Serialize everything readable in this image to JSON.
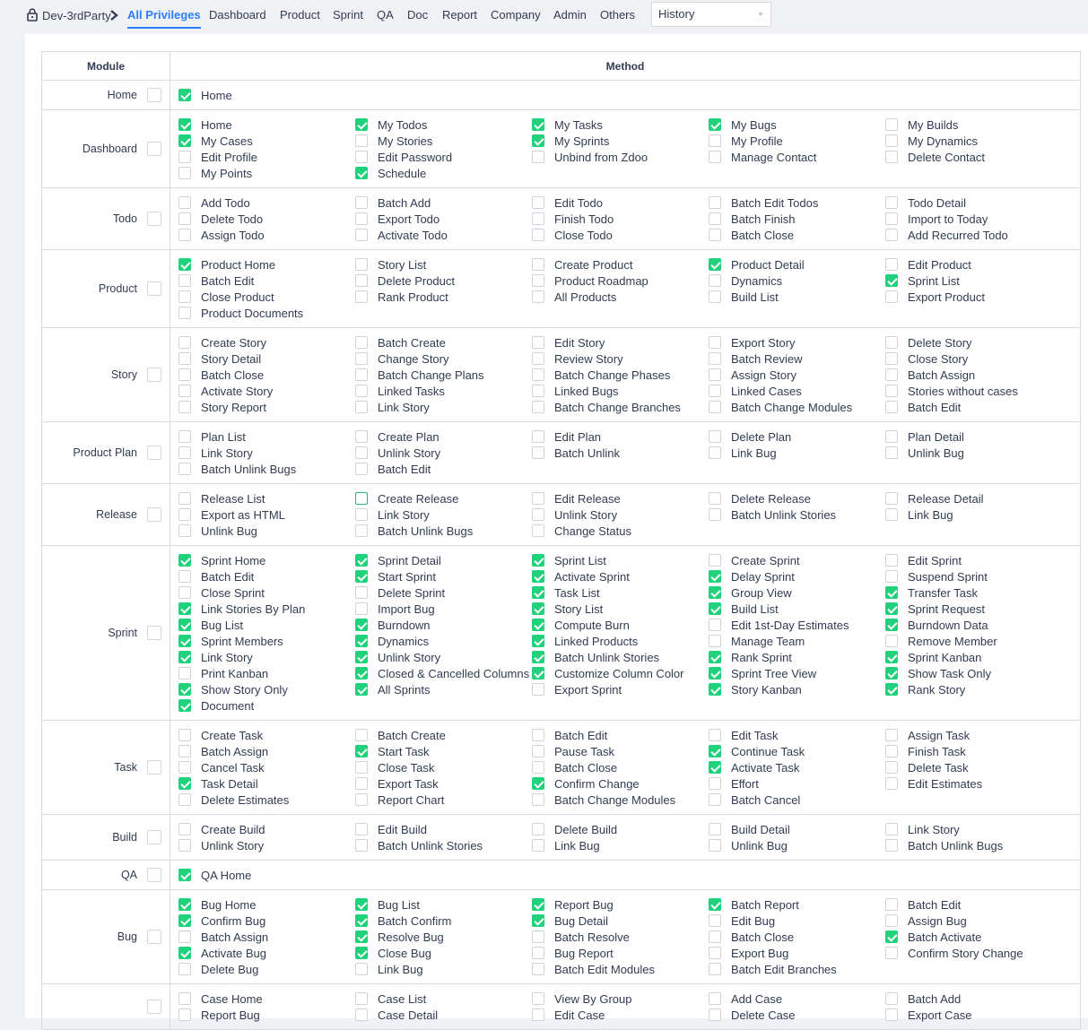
{
  "breadcrumb": {
    "root": "Dev-3rdParty",
    "current": "All Privileges"
  },
  "nav": [
    "Dashboard",
    "Product",
    "Sprint",
    "QA",
    "Doc",
    "Report",
    "Company",
    "Admin",
    "Others"
  ],
  "version_select": {
    "value": "History"
  },
  "table": {
    "header_module": "Module",
    "header_method": "Method"
  },
  "colors": {
    "checked": "#1fd27b",
    "accent": "#2e7fff",
    "border": "#d8dbde"
  },
  "modules": [
    {
      "name": "Home",
      "items": [
        [
          "Home",
          1
        ]
      ]
    },
    {
      "name": "Dashboard",
      "items": [
        [
          "Home",
          1
        ],
        [
          "My Todos",
          1
        ],
        [
          "My Tasks",
          1
        ],
        [
          "My Bugs",
          1
        ],
        [
          "My Builds",
          0
        ],
        [
          "My Cases",
          1
        ],
        [
          "My Stories",
          0
        ],
        [
          "My Sprints",
          1
        ],
        [
          "My Profile",
          0
        ],
        [
          "My Dynamics",
          0
        ],
        [
          "Edit Profile",
          0
        ],
        [
          "Edit Password",
          0
        ],
        [
          "Unbind from Zdoo",
          0
        ],
        [
          "Manage Contact",
          0
        ],
        [
          "Delete Contact",
          0
        ],
        [
          "My Points",
          0
        ],
        [
          "Schedule",
          1
        ]
      ]
    },
    {
      "name": "Todo",
      "items": [
        [
          "Add Todo",
          0
        ],
        [
          "Batch Add",
          0
        ],
        [
          "Edit Todo",
          0
        ],
        [
          "Batch Edit Todos",
          0
        ],
        [
          "Todo Detail",
          0
        ],
        [
          "Delete Todo",
          0
        ],
        [
          "Export Todo",
          0
        ],
        [
          "Finish Todo",
          0
        ],
        [
          "Batch Finish",
          0
        ],
        [
          "Import to Today",
          0
        ],
        [
          "Assign Todo",
          0
        ],
        [
          "Activate Todo",
          0
        ],
        [
          "Close Todo",
          0
        ],
        [
          "Batch Close",
          0
        ],
        [
          "Add Recurred Todo",
          0
        ]
      ]
    },
    {
      "name": "Product",
      "items": [
        [
          "Product Home",
          1
        ],
        [
          "Story List",
          0
        ],
        [
          "Create Product",
          0
        ],
        [
          "Product Detail",
          1
        ],
        [
          "Edit Product",
          0
        ],
        [
          "Batch Edit",
          0
        ],
        [
          "Delete Product",
          0
        ],
        [
          "Product Roadmap",
          0
        ],
        [
          "Dynamics",
          0
        ],
        [
          "Sprint List",
          1
        ],
        [
          "Close Product",
          0
        ],
        [
          "Rank Product",
          0
        ],
        [
          "All Products",
          0
        ],
        [
          "Build List",
          0
        ],
        [
          "Export Product",
          0
        ],
        [
          "Product Documents",
          0
        ]
      ]
    },
    {
      "name": "Story",
      "items": [
        [
          "Create Story",
          0
        ],
        [
          "Batch Create",
          0
        ],
        [
          "Edit Story",
          0
        ],
        [
          "Export Story",
          0
        ],
        [
          "Delete Story",
          0
        ],
        [
          "Story Detail",
          0
        ],
        [
          "Change Story",
          0
        ],
        [
          "Review Story",
          0
        ],
        [
          "Batch Review",
          0
        ],
        [
          "Close Story",
          0
        ],
        [
          "Batch Close",
          0
        ],
        [
          "Batch Change Plans",
          0
        ],
        [
          "Batch Change Phases",
          0
        ],
        [
          "Assign Story",
          0
        ],
        [
          "Batch Assign",
          0
        ],
        [
          "Activate Story",
          0
        ],
        [
          "Linked Tasks",
          0
        ],
        [
          "Linked Bugs",
          0
        ],
        [
          "Linked Cases",
          0
        ],
        [
          "Stories without cases",
          0
        ],
        [
          "Story Report",
          0
        ],
        [
          "Link Story",
          0
        ],
        [
          "Batch Change Branches",
          0
        ],
        [
          "Batch Change Modules",
          0
        ],
        [
          "Batch Edit",
          0
        ]
      ]
    },
    {
      "name": "Product Plan",
      "items": [
        [
          "Plan List",
          0
        ],
        [
          "Create Plan",
          0
        ],
        [
          "Edit Plan",
          0
        ],
        [
          "Delete Plan",
          0
        ],
        [
          "Plan Detail",
          0
        ],
        [
          "Link Story",
          0
        ],
        [
          "Unlink Story",
          0
        ],
        [
          "Batch Unlink",
          0
        ],
        [
          "Link Bug",
          0
        ],
        [
          "Unlink Bug",
          0
        ],
        [
          "Batch Unlink Bugs",
          0
        ],
        [
          "Batch Edit",
          0
        ]
      ]
    },
    {
      "name": "Release",
      "items": [
        [
          "Release List",
          0
        ],
        [
          "Create Release",
          2
        ],
        [
          "Edit Release",
          0
        ],
        [
          "Delete Release",
          0
        ],
        [
          "Release Detail",
          0
        ],
        [
          "Export as HTML",
          0
        ],
        [
          "Link Story",
          0
        ],
        [
          "Unlink Story",
          0
        ],
        [
          "Batch Unlink Stories",
          0
        ],
        [
          "Link Bug",
          0
        ],
        [
          "Unlink Bug",
          0
        ],
        [
          "Batch Unlink Bugs",
          0
        ],
        [
          "Change Status",
          0
        ]
      ]
    },
    {
      "name": "Sprint",
      "items": [
        [
          "Sprint Home",
          1
        ],
        [
          "Sprint Detail",
          1
        ],
        [
          "Sprint List",
          1
        ],
        [
          "Create Sprint",
          0
        ],
        [
          "Edit Sprint",
          0
        ],
        [
          "Batch Edit",
          0
        ],
        [
          "Start Sprint",
          1
        ],
        [
          "Activate Sprint",
          1
        ],
        [
          "Delay Sprint",
          1
        ],
        [
          "Suspend Sprint",
          0
        ],
        [
          "Close Sprint",
          0
        ],
        [
          "Delete Sprint",
          0
        ],
        [
          "Task List",
          1
        ],
        [
          "Group View",
          1
        ],
        [
          "Transfer Task",
          1
        ],
        [
          "Link Stories By Plan",
          1
        ],
        [
          "Import Bug",
          0
        ],
        [
          "Story List",
          1
        ],
        [
          "Build List",
          1
        ],
        [
          "Sprint Request",
          1
        ],
        [
          "Bug List",
          1
        ],
        [
          "Burndown",
          1
        ],
        [
          "Compute Burn",
          1
        ],
        [
          "Edit 1st-Day Estimates",
          0
        ],
        [
          "Burndown Data",
          1
        ],
        [
          "Sprint Members",
          1
        ],
        [
          "Dynamics",
          1
        ],
        [
          "Linked Products",
          1
        ],
        [
          "Manage Team",
          0
        ],
        [
          "Remove Member",
          0
        ],
        [
          "Link Story",
          1
        ],
        [
          "Unlink Story",
          1
        ],
        [
          "Batch Unlink Stories",
          1
        ],
        [
          "Rank Sprint",
          1
        ],
        [
          "Sprint Kanban",
          1
        ],
        [
          "Print Kanban",
          0
        ],
        [
          "Closed & Cancelled Columns",
          1
        ],
        [
          "Customize Column Color",
          1
        ],
        [
          "Sprint Tree View",
          1
        ],
        [
          "Show Task Only",
          1
        ],
        [
          "Show Story Only",
          1
        ],
        [
          "All Sprints",
          1
        ],
        [
          "Export Sprint",
          0
        ],
        [
          "Story Kanban",
          1
        ],
        [
          "Rank Story",
          1
        ],
        [
          "Document",
          1
        ]
      ]
    },
    {
      "name": "Task",
      "items": [
        [
          "Create Task",
          0
        ],
        [
          "Batch Create",
          0
        ],
        [
          "Batch Edit",
          0
        ],
        [
          "Edit Task",
          0
        ],
        [
          "Assign Task",
          0
        ],
        [
          "Batch Assign",
          0
        ],
        [
          "Start Task",
          1
        ],
        [
          "Pause Task",
          0
        ],
        [
          "Continue Task",
          1
        ],
        [
          "Finish Task",
          0
        ],
        [
          "Cancel Task",
          0
        ],
        [
          "Close Task",
          0
        ],
        [
          "Batch Close",
          0
        ],
        [
          "Activate Task",
          1
        ],
        [
          "Delete Task",
          0
        ],
        [
          "Task Detail",
          1
        ],
        [
          "Export Task",
          0
        ],
        [
          "Confirm Change",
          1
        ],
        [
          "Effort",
          0
        ],
        [
          "Edit Estimates",
          0
        ],
        [
          "Delete Estimates",
          0
        ],
        [
          "Report Chart",
          0
        ],
        [
          "Batch Change Modules",
          0
        ],
        [
          "Batch Cancel",
          0
        ]
      ]
    },
    {
      "name": "Build",
      "items": [
        [
          "Create Build",
          0
        ],
        [
          "Edit Build",
          0
        ],
        [
          "Delete Build",
          0
        ],
        [
          "Build Detail",
          0
        ],
        [
          "Link Story",
          0
        ],
        [
          "Unlink Story",
          0
        ],
        [
          "Batch Unlink Stories",
          0
        ],
        [
          "Link Bug",
          0
        ],
        [
          "Unlink Bug",
          0
        ],
        [
          "Batch Unlink Bugs",
          0
        ]
      ]
    },
    {
      "name": "QA",
      "items": [
        [
          "QA Home",
          1
        ]
      ]
    },
    {
      "name": "Bug",
      "items": [
        [
          "Bug Home",
          1
        ],
        [
          "Bug List",
          1
        ],
        [
          "Report Bug",
          1
        ],
        [
          "Batch Report",
          1
        ],
        [
          "Batch Edit",
          0
        ],
        [
          "Confirm Bug",
          1
        ],
        [
          "Batch Confirm",
          1
        ],
        [
          "Bug Detail",
          1
        ],
        [
          "Edit Bug",
          0
        ],
        [
          "Assign Bug",
          0
        ],
        [
          "Batch Assign",
          0
        ],
        [
          "Resolve Bug",
          1
        ],
        [
          "Batch Resolve",
          0
        ],
        [
          "Batch Close",
          0
        ],
        [
          "Batch Activate",
          1
        ],
        [
          "Activate Bug",
          1
        ],
        [
          "Close Bug",
          1
        ],
        [
          "Bug Report",
          0
        ],
        [
          "Export Bug",
          0
        ],
        [
          "Confirm Story Change",
          0
        ],
        [
          "Delete Bug",
          0
        ],
        [
          "Link Bug",
          0
        ],
        [
          "Batch Edit Modules",
          0
        ],
        [
          "Batch Edit Branches",
          0
        ]
      ]
    },
    {
      "name": "",
      "items": [
        [
          "Case Home",
          0
        ],
        [
          "Case List",
          0
        ],
        [
          "View By Group",
          0
        ],
        [
          "Add Case",
          0
        ],
        [
          "Batch Add",
          0
        ],
        [
          "Report Bug",
          0
        ],
        [
          "Case Detail",
          0
        ],
        [
          "Edit Case",
          0
        ],
        [
          "Delete Case",
          0
        ],
        [
          "Export Case",
          0
        ]
      ]
    }
  ]
}
